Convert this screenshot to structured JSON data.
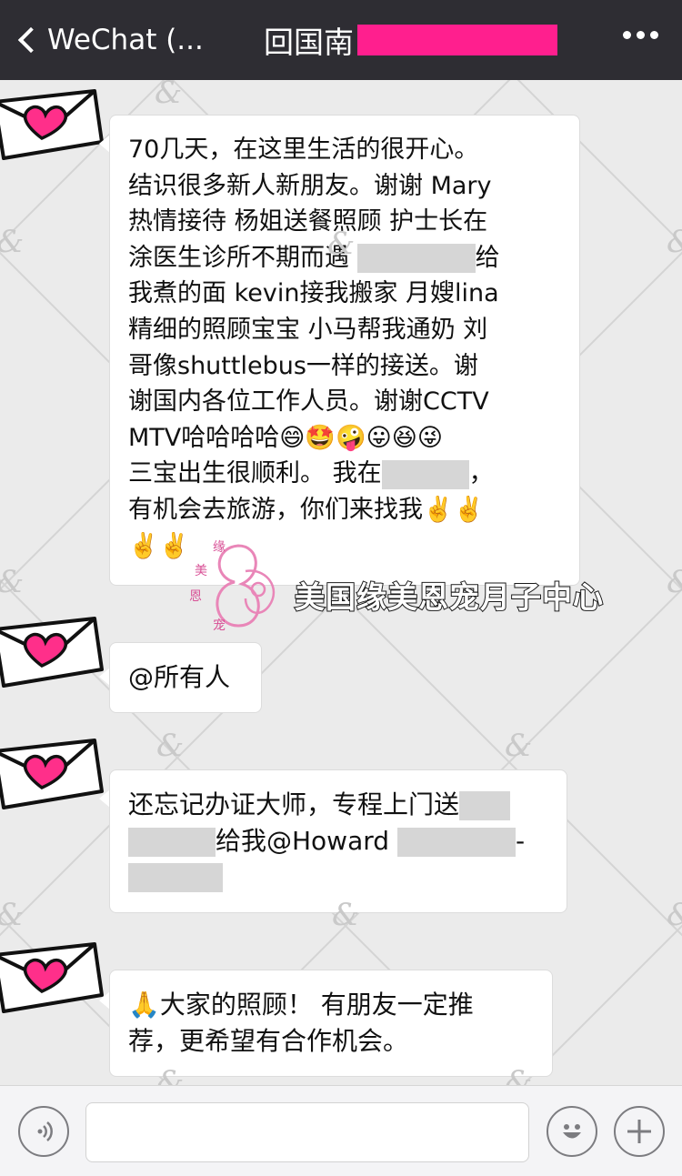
{
  "header": {
    "back_label": "WeChat (...",
    "title": "回国南"
  },
  "messages": [
    {
      "id": "m1",
      "lines": [
        [
          {
            "t": "70几天，在这里生活的很开心。"
          }
        ],
        [
          {
            "t": "结识很多新人新朋友。谢谢 Mary"
          }
        ],
        [
          {
            "t": "热情接待 杨姐送餐照顾 护士长在"
          }
        ],
        [
          {
            "t": "涂医生诊所不期而遇 "
          },
          {
            "redact": 130
          },
          {
            "t": "给"
          }
        ],
        [
          {
            "t": "我煮的面 kevin接我搬家 月嫂lina"
          }
        ],
        [
          {
            "t": "精细的照顾宝宝 小马帮我通奶 刘"
          }
        ],
        [
          {
            "t": "哥像shuttlebus一样的接送。谢"
          }
        ],
        [
          {
            "t": "谢国内各位工作人员。谢谢CCTV"
          }
        ],
        [
          {
            "t": "MTV哈哈哈哈😄🤩🤪😛😆😜"
          }
        ],
        [
          {
            "t": "三宝出生很顺利。 我在"
          },
          {
            "redact": 96
          },
          {
            "t": "，"
          }
        ],
        [
          {
            "t": "有机会去旅游，你们来找我✌️✌️"
          }
        ],
        [
          {
            "t": "✌️✌️"
          }
        ]
      ]
    },
    {
      "id": "m2",
      "lines": [
        [
          {
            "t": "@所有人"
          }
        ]
      ]
    },
    {
      "id": "m3",
      "lines": [
        [
          {
            "t": "还忘记办证大师，专程上门送"
          },
          {
            "redact": 56
          }
        ],
        [
          {
            "redact": 96
          },
          {
            "t": "给我@Howard "
          },
          {
            "redact": 130
          },
          {
            "t": "-"
          }
        ],
        [
          {
            "redact": 104
          }
        ]
      ]
    },
    {
      "id": "m4",
      "lines": [
        [
          {
            "t": "🙏大家的照顾！ 有朋友一定推"
          }
        ],
        [
          {
            "t": "荐，更希望有合作机会。"
          }
        ]
      ]
    }
  ],
  "logo": {
    "text": "美国缘美恩宠月子中心",
    "mark_chars": [
      "缘",
      "美",
      "恩",
      "宠"
    ]
  },
  "colors": {
    "header_bg": "#2e2d33",
    "redact_title": "#ff1f8e",
    "heart": "#ff2f8a"
  },
  "icons": {
    "voice": "voice-icon",
    "emoji": "emoji-icon",
    "plus": "plus-icon",
    "more": "more-icon",
    "back": "back-chevron-icon"
  }
}
